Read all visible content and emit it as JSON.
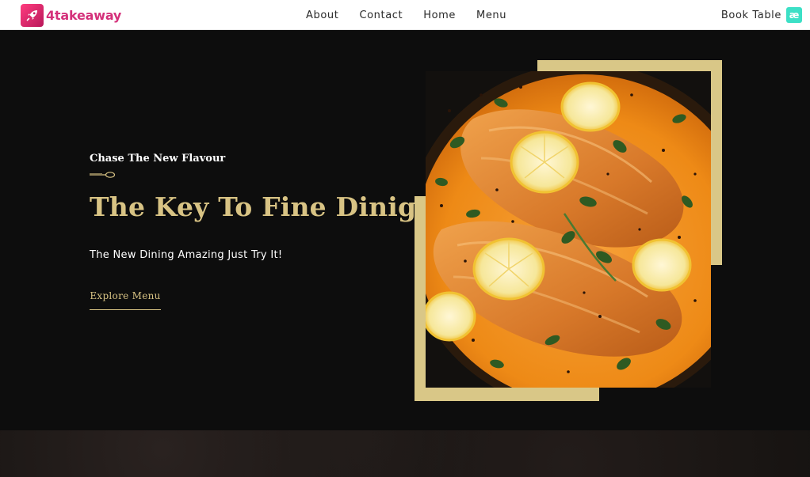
{
  "brand": {
    "name": "4takeaway",
    "icon": "rocket-icon",
    "color": "#d4307a"
  },
  "nav": {
    "items": [
      {
        "label": "About"
      },
      {
        "label": "Contact"
      },
      {
        "label": "Home"
      },
      {
        "label": "Menu"
      }
    ],
    "cta_label": "Book Table",
    "cta_icon": "ae-icon"
  },
  "hero": {
    "kicker": "Chase The New Flavour",
    "title": "The Key To Fine Dinig",
    "subtitle": "The New Dining Amazing Just Try It!",
    "button_label": "Explore Menu",
    "image": "salmon-dish-photo",
    "accent_color": "#d8c384",
    "frame_color": "#d9c787",
    "background_color": "#0d0d0d"
  }
}
